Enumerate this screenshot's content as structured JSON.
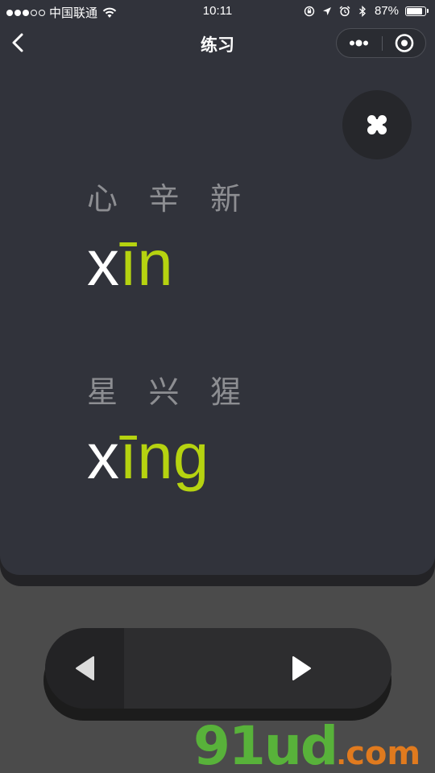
{
  "status_bar": {
    "carrier": "中国联通",
    "time": "10:11",
    "battery": "87%",
    "battery_level": 0.87,
    "signal_bars_filled": 3,
    "signal_bars_total": 5
  },
  "nav": {
    "title": "练习"
  },
  "practice": {
    "groups": [
      {
        "hanzi": "心 辛 新",
        "pinyin_initial": "x",
        "pinyin_final": "īn"
      },
      {
        "hanzi": "星 兴 猩",
        "pinyin_initial": "x",
        "pinyin_final": "īng"
      }
    ]
  },
  "watermark": {
    "main": "91ud",
    "dot": ".",
    "suffix": "com"
  },
  "colors": {
    "card_bg": "#31333b",
    "page_bg": "#4b4b4b",
    "accent": "#b6d310",
    "hanzi": "#8d8e92",
    "watermark_green": "#58b23a",
    "watermark_orange": "#e07a1e"
  },
  "icons": {
    "back": "chevron-left-icon",
    "more": "more-dots-icon",
    "close": "target-circle-icon",
    "grid": "four-petal-grid-icon",
    "prev": "triangle-left-icon",
    "next": "triangle-right-icon"
  }
}
